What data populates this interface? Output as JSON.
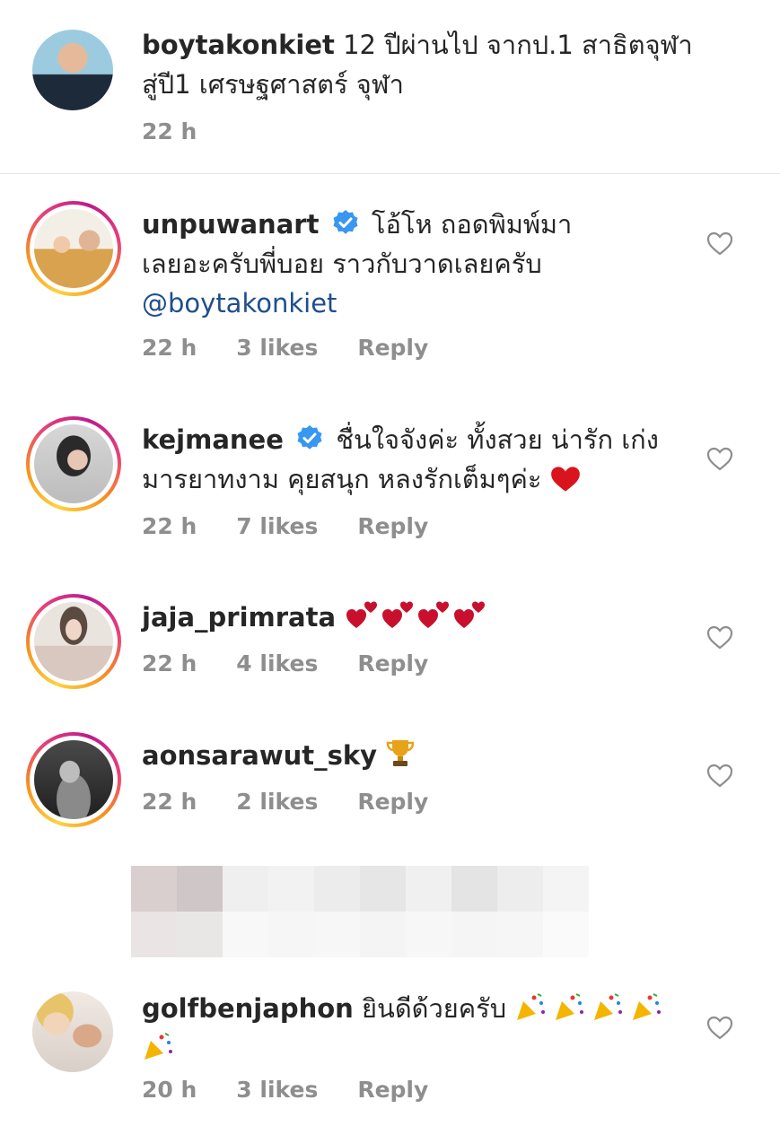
{
  "caption": {
    "username": "boytakonkiet",
    "text_line1": " 12 ปีผ่านไป จากป.1 สาธิตจุฬา",
    "text_line2": "สู่ปี1 เศรษฐศาสตร์ จุฬา",
    "time": "22 h"
  },
  "comments": [
    {
      "username": "unpuwanart",
      "text_line1": "โอ้โห ถอดพิมพ์มา",
      "text_line2": "เลยอะครับพี่บอย ราวกับวาดเลยครับ",
      "mention": "@boytakonkiet",
      "time": "22 h",
      "likes": "3 likes",
      "reply": "Reply"
    },
    {
      "username": "kejmanee",
      "text_line1": "ชื่นใจจังค่ะ ทั้งสวย น่ารัก เก่ง",
      "text_line2": "มารยาทงาม คุยสนุก หลงรักเต็มๆค่ะ",
      "time": "22 h",
      "likes": "7 likes",
      "reply": "Reply"
    },
    {
      "username": "jaja_primrata",
      "time": "22 h",
      "likes": "4 likes",
      "reply": "Reply"
    },
    {
      "username": "aonsarawut_sky",
      "time": "22 h",
      "likes": "2 likes",
      "reply": "Reply"
    },
    {
      "username": "golfbenjaphon",
      "text_line1": " ยินดีด้วยครับ",
      "time": "20 h",
      "likes": "3 likes",
      "reply": "Reply"
    }
  ],
  "icons": {
    "verified": "verified-badge-icon",
    "like": "heart-outline-icon",
    "red_heart": "red-heart-emoji",
    "two_hearts": "heart-exclamation-emoji",
    "trophy": "trophy-emoji",
    "party": "party-popper-emoji"
  },
  "colors": {
    "text": "#262626",
    "meta": "#8e8e8e",
    "mention": "#1f4e8d",
    "verified": "#3897f0",
    "heart_emoji": "#d9141c"
  }
}
